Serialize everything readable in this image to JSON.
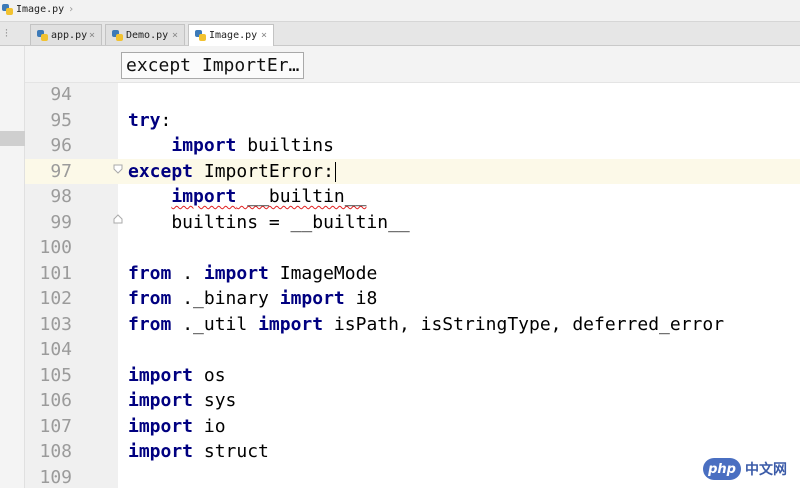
{
  "breadcrumb": {
    "file": "Image.py"
  },
  "tabs": [
    {
      "label": "app.py",
      "close": "×",
      "active": false
    },
    {
      "label": "Demo.py",
      "close": "×",
      "active": false
    },
    {
      "label": "Image.py",
      "close": "×",
      "active": true
    }
  ],
  "editor": {
    "current_line": 97,
    "structure_hint": "except ImportEr…",
    "lines": [
      {
        "num": "94",
        "segments": []
      },
      {
        "num": "95",
        "segments": [
          {
            "t": "try",
            "k": "kw"
          },
          {
            "t": ":",
            "k": ""
          }
        ]
      },
      {
        "num": "96",
        "segments": [
          {
            "t": "    ",
            "k": ""
          },
          {
            "t": "import",
            "k": "kw"
          },
          {
            "t": " builtins",
            "k": ""
          }
        ]
      },
      {
        "num": "97",
        "segments": [
          {
            "t": "except",
            "k": "kw"
          },
          {
            "t": " ImportError:",
            "k": ""
          }
        ]
      },
      {
        "num": "98",
        "segments": [
          {
            "t": "    ",
            "k": ""
          },
          {
            "t": "import",
            "k": "kw sq"
          },
          {
            "t": " __builtin__",
            "k": "sq"
          }
        ]
      },
      {
        "num": "99",
        "segments": [
          {
            "t": "    builtins = __builtin__",
            "k": ""
          }
        ]
      },
      {
        "num": "100",
        "segments": []
      },
      {
        "num": "101",
        "segments": [
          {
            "t": "from",
            "k": "kw"
          },
          {
            "t": " . ",
            "k": ""
          },
          {
            "t": "import",
            "k": "kw"
          },
          {
            "t": " ImageMode",
            "k": ""
          }
        ]
      },
      {
        "num": "102",
        "segments": [
          {
            "t": "from",
            "k": "kw"
          },
          {
            "t": " ._binary ",
            "k": ""
          },
          {
            "t": "import",
            "k": "kw"
          },
          {
            "t": " i8",
            "k": ""
          }
        ]
      },
      {
        "num": "103",
        "segments": [
          {
            "t": "from",
            "k": "kw"
          },
          {
            "t": " ._util ",
            "k": ""
          },
          {
            "t": "import",
            "k": "kw"
          },
          {
            "t": " isPath, isStringType, deferred_error",
            "k": ""
          }
        ]
      },
      {
        "num": "104",
        "segments": []
      },
      {
        "num": "105",
        "segments": [
          {
            "t": "import",
            "k": "kw"
          },
          {
            "t": " os",
            "k": ""
          }
        ]
      },
      {
        "num": "106",
        "segments": [
          {
            "t": "import",
            "k": "kw"
          },
          {
            "t": " sys",
            "k": ""
          }
        ]
      },
      {
        "num": "107",
        "segments": [
          {
            "t": "import",
            "k": "kw"
          },
          {
            "t": " io",
            "k": ""
          }
        ]
      },
      {
        "num": "108",
        "segments": [
          {
            "t": "import",
            "k": "kw"
          },
          {
            "t": " struct",
            "k": ""
          }
        ]
      },
      {
        "num": "109",
        "segments": []
      }
    ]
  },
  "watermark": {
    "badge": "php",
    "text": "中文网"
  },
  "colors": {
    "keyword": "#000080",
    "current_line_bg": "#fcf9e8",
    "error_underline": "#e02020"
  },
  "icons": {
    "file_icon": "python-file-icon",
    "pin": "pin-icon",
    "close": "close-icon",
    "fold": "fold-marker-icon"
  }
}
